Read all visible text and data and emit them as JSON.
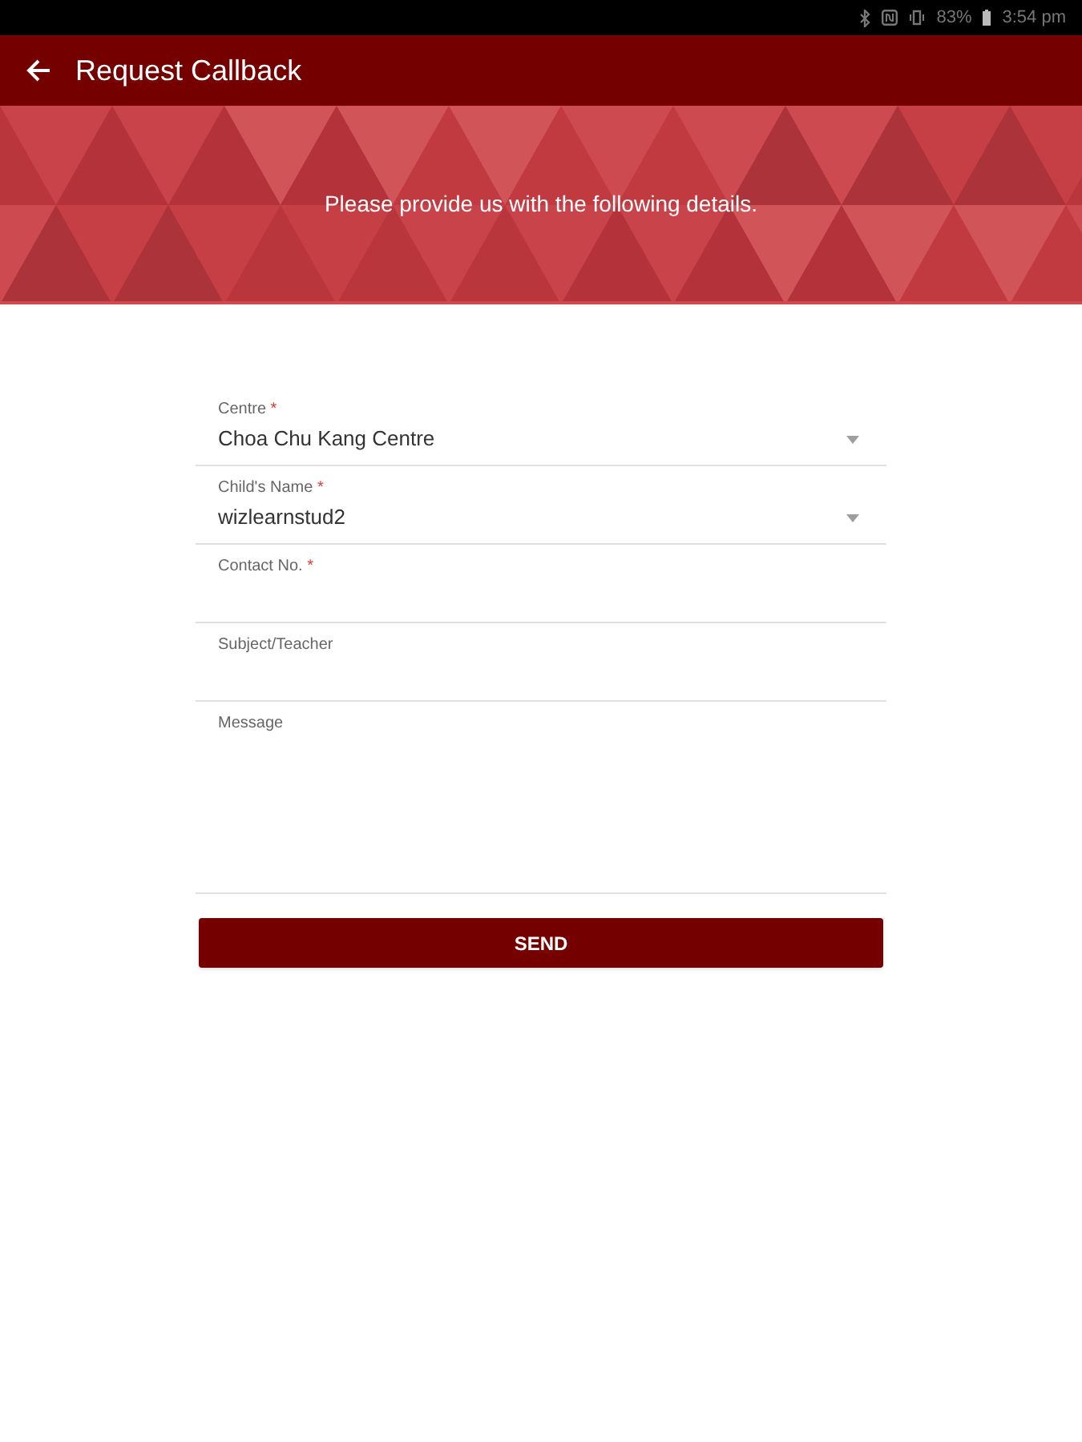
{
  "status_bar": {
    "battery": "83%",
    "time": "3:54 pm"
  },
  "app_bar": {
    "title": "Request Callback"
  },
  "banner": {
    "text": "Please provide us with the following details."
  },
  "form": {
    "fields": [
      {
        "kind": "select",
        "label": "Centre",
        "required_mark": "*",
        "value": "Choa Chu Kang Centre"
      },
      {
        "kind": "select",
        "label": "Child's Name",
        "required_mark": "*",
        "value": "wizlearnstud2"
      },
      {
        "kind": "text",
        "label": "Contact No.",
        "required_mark": "*"
      },
      {
        "kind": "text",
        "label": "Subject/Teacher"
      },
      {
        "kind": "textarea",
        "label": "Message"
      }
    ]
  },
  "send_button": {
    "label": "SEND"
  }
}
